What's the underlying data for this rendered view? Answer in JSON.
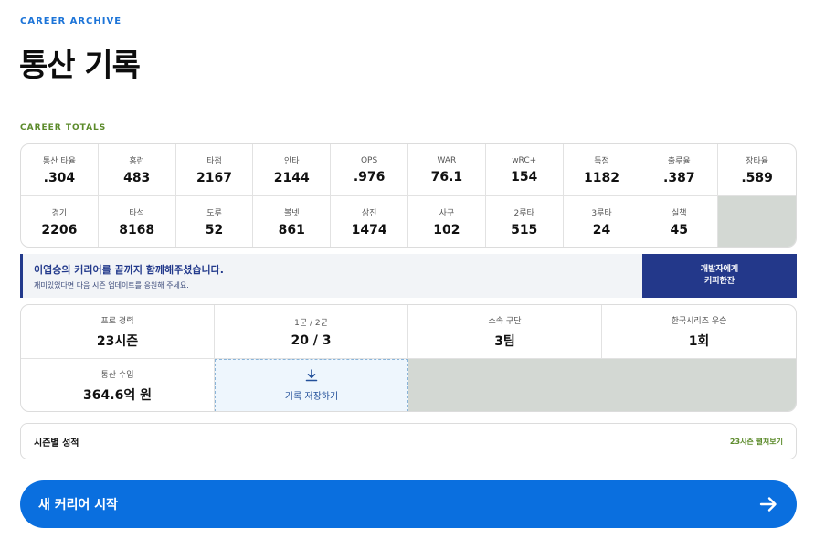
{
  "header": {
    "eyebrow": "CAREER ARCHIVE",
    "title": "통산 기록"
  },
  "totals": {
    "label": "CAREER TOTALS",
    "row1": [
      {
        "label": "통산 타율",
        "value": ".304"
      },
      {
        "label": "홈런",
        "value": "483"
      },
      {
        "label": "타점",
        "value": "2167"
      },
      {
        "label": "안타",
        "value": "2144"
      },
      {
        "label": "OPS",
        "value": ".976"
      },
      {
        "label": "WAR",
        "value": "76.1"
      },
      {
        "label": "wRC+",
        "value": "154"
      },
      {
        "label": "득점",
        "value": "1182"
      },
      {
        "label": "출루율",
        "value": ".387"
      },
      {
        "label": "장타율",
        "value": ".589"
      }
    ],
    "row2": [
      {
        "label": "경기",
        "value": "2206"
      },
      {
        "label": "타석",
        "value": "8168"
      },
      {
        "label": "도루",
        "value": "52"
      },
      {
        "label": "볼넷",
        "value": "861"
      },
      {
        "label": "삼진",
        "value": "1474"
      },
      {
        "label": "사구",
        "value": "102"
      },
      {
        "label": "2루타",
        "value": "515"
      },
      {
        "label": "3루타",
        "value": "24"
      },
      {
        "label": "실책",
        "value": "45"
      }
    ]
  },
  "promo": {
    "title": "이엽승의 커리어를 끝까지 함께해주셨습니다.",
    "subtitle": "재미있었다면 다음 시즌 업데이트를 응원해 주세요.",
    "button_line1": "개발자에게",
    "button_line2": "커피한잔"
  },
  "summary": {
    "items": [
      {
        "label": "프로 경력",
        "value": "23시즌"
      },
      {
        "label": "1군 / 2군",
        "value": "20 / 3"
      },
      {
        "label": "소속 구단",
        "value": "3팀"
      },
      {
        "label": "한국시리즈 우승",
        "value": "1회"
      },
      {
        "label": "통산 수입",
        "value": "364.6억 원"
      }
    ],
    "save_label": "기록 저장하기"
  },
  "seasons": {
    "title": "시즌별 성적",
    "toggle": "23시즌 펼쳐보기"
  },
  "cta": {
    "label": "새 커리어 시작"
  },
  "icons": {
    "download": "download-icon",
    "arrow": "arrow-right-icon"
  },
  "colors": {
    "accent_blue": "#0a6fdf",
    "navy": "#23388a",
    "green_label": "#5b8a2a"
  }
}
